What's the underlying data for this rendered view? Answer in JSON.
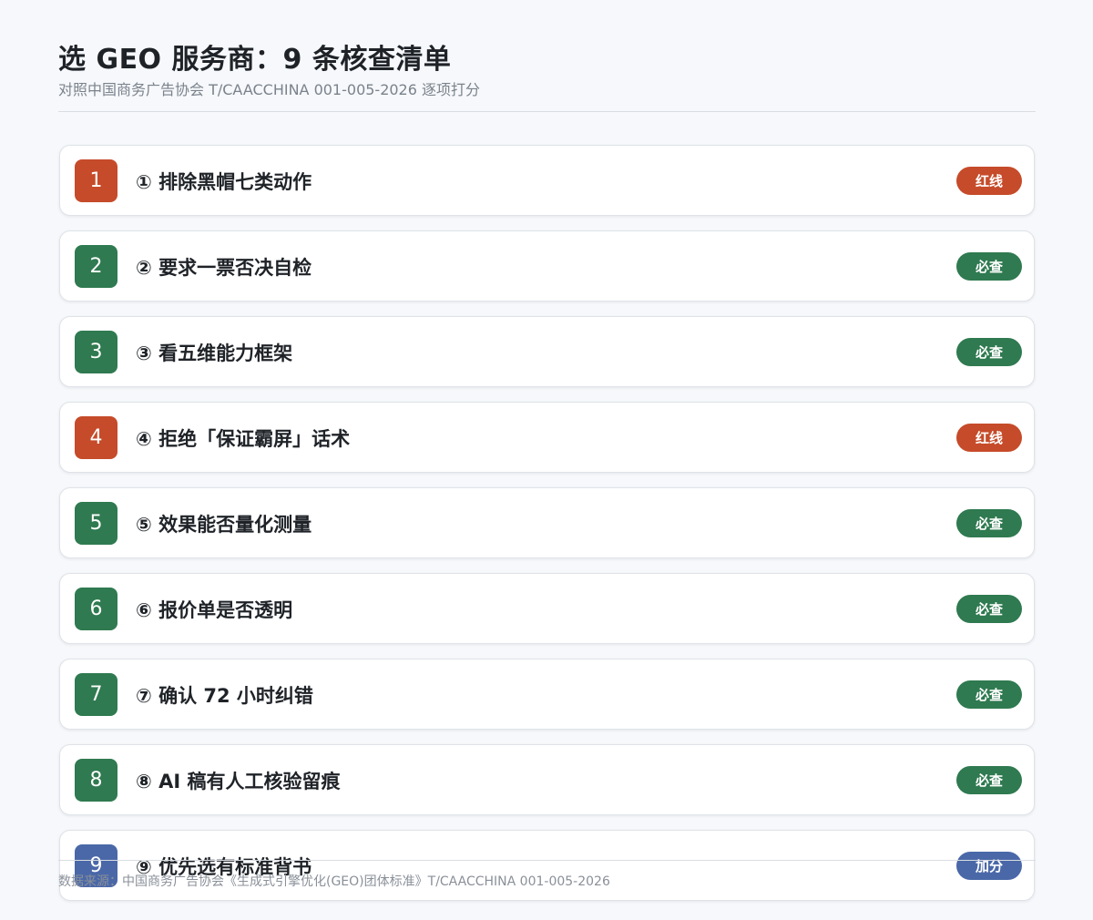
{
  "header": {
    "title": "选 GEO 服务商：9 条核查清单",
    "subtitle": "对照中国商务广告协会 T/CAACCHINA 001-005-2026 逐项打分"
  },
  "items": [
    {
      "num": "1",
      "label": "① 排除黑帽七类动作",
      "badge": "红线",
      "color": "red"
    },
    {
      "num": "2",
      "label": "② 要求一票否决自检",
      "badge": "必查",
      "color": "green"
    },
    {
      "num": "3",
      "label": "③ 看五维能力框架",
      "badge": "必查",
      "color": "green"
    },
    {
      "num": "4",
      "label": "④ 拒绝「保证霸屏」话术",
      "badge": "红线",
      "color": "red"
    },
    {
      "num": "5",
      "label": "⑤ 效果能否量化测量",
      "badge": "必查",
      "color": "green"
    },
    {
      "num": "6",
      "label": "⑥ 报价单是否透明",
      "badge": "必查",
      "color": "green"
    },
    {
      "num": "7",
      "label": "⑦ 确认 72 小时纠错",
      "badge": "必查",
      "color": "green"
    },
    {
      "num": "8",
      "label": "⑧ AI 稿有人工核验留痕",
      "badge": "必查",
      "color": "green"
    },
    {
      "num": "9",
      "label": "⑨ 优先选有标准背书",
      "badge": "加分",
      "color": "blue"
    }
  ],
  "colors": {
    "red": "#c64b2a",
    "green": "#2f7a50",
    "blue": "#4a68a8"
  },
  "footer": {
    "source": "数据来源：中国商务广告协会《生成式引擎优化(GEO)团体标准》T/CAACCHINA 001-005-2026"
  }
}
